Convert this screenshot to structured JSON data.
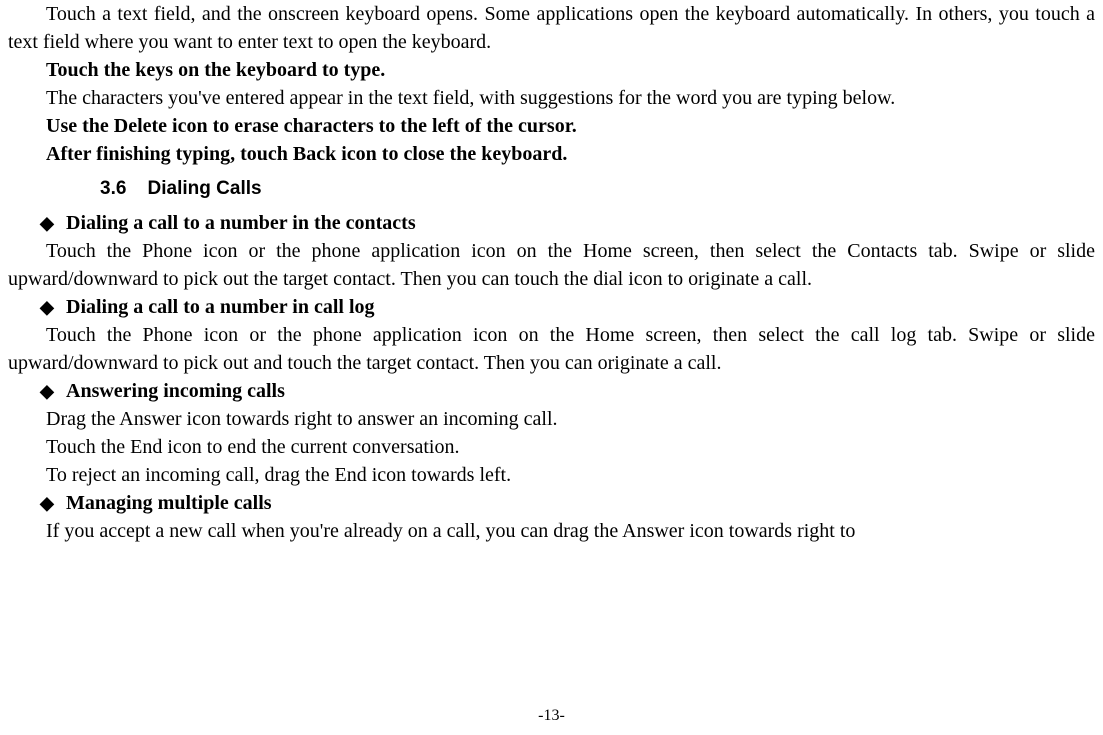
{
  "paragraphs": {
    "p1": "Touch a text field, and the onscreen keyboard opens. Some applications open the keyboard automatically. In others, you touch a text field where you want to enter text to open the keyboard.",
    "p2": "Touch the keys on the keyboard to type.",
    "p3": "The characters you've entered appear in the text field, with suggestions for the word you are typing below.",
    "p4": "Use the Delete icon to erase characters to the left of the cursor.",
    "p5": "After finishing typing, touch Back icon to close the keyboard."
  },
  "section": {
    "number": "3.6",
    "title": "Dialing Calls"
  },
  "bullets": {
    "b1": {
      "title": "Dialing a call to a number in the contacts",
      "body": "Touch the Phone icon or the phone application icon on the Home screen, then select the Contacts tab. Swipe or slide upward/downward to pick out the target contact. Then you can touch the dial icon to originate a call."
    },
    "b2": {
      "title": "Dialing a call to a number in call log",
      "body": "Touch the Phone icon or the phone application icon on the Home screen, then select the call log tab. Swipe or slide upward/downward to pick out and touch the target contact. Then you can originate a call."
    },
    "b3": {
      "title": "Answering incoming calls",
      "line1": "Drag the Answer icon towards right to answer an incoming call.",
      "line2": "Touch the End icon to end the current conversation.",
      "line3": "To reject an incoming call, drag the End icon towards left."
    },
    "b4": {
      "title": "Managing multiple calls",
      "body": "If you accept a new call when you're already on a call, you can drag the Answer icon towards right to"
    }
  },
  "page_number": "-13-"
}
